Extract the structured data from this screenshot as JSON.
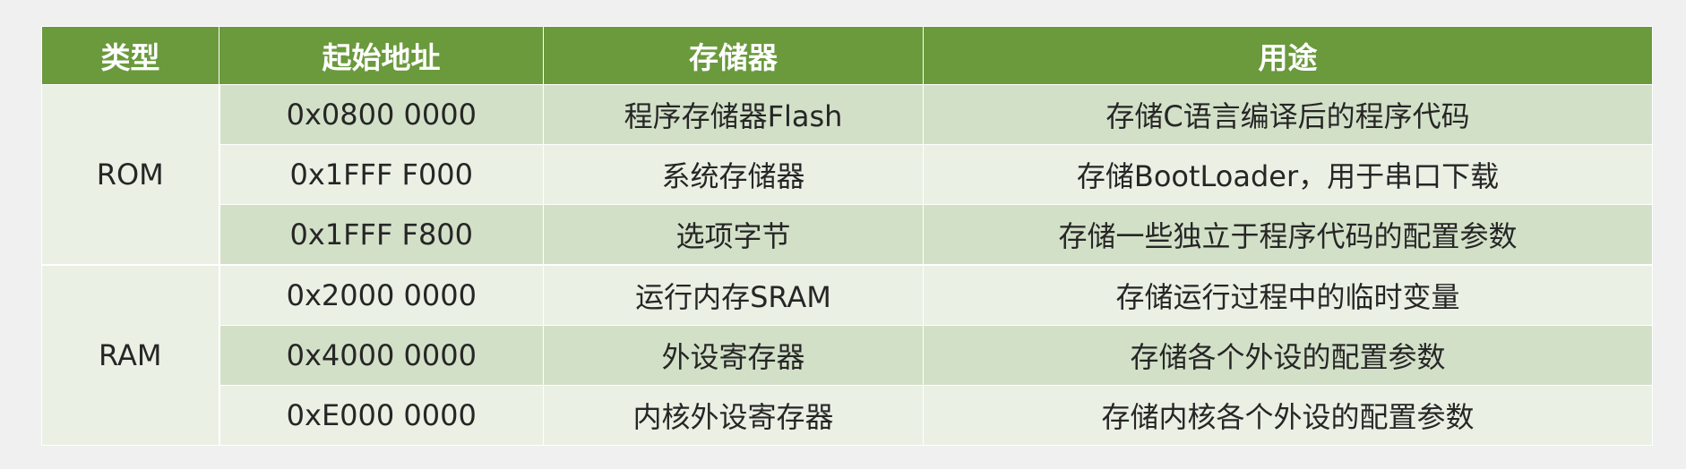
{
  "table": {
    "headers": [
      "类型",
      "起始地址",
      "存储器",
      "用途"
    ],
    "groups": [
      {
        "type": "ROM",
        "rows": [
          {
            "address": "0x0800 0000",
            "memory": "程序存储器Flash",
            "usage": "存储C语言编译后的程序代码"
          },
          {
            "address": "0x1FFF F000",
            "memory": "系统存储器",
            "usage": "存储BootLoader，用于串口下载"
          },
          {
            "address": "0x1FFF F800",
            "memory": "选项字节",
            "usage": "存储一些独立于程序代码的配置参数"
          }
        ]
      },
      {
        "type": "RAM",
        "rows": [
          {
            "address": "0x2000 0000",
            "memory": "运行内存SRAM",
            "usage": "存储运行过程中的临时变量"
          },
          {
            "address": "0x4000 0000",
            "memory": "外设寄存器",
            "usage": "存储各个外设的配置参数"
          },
          {
            "address": "0xE000 0000",
            "memory": "内核外设寄存器",
            "usage": "存储内核各个外设的配置参数"
          }
        ]
      }
    ]
  },
  "colors": {
    "header_bg": "#6a9a3c",
    "row_dark": "#d3e0c8",
    "row_light": "#eaf0e4",
    "page_bg": "#f0f0f0"
  }
}
